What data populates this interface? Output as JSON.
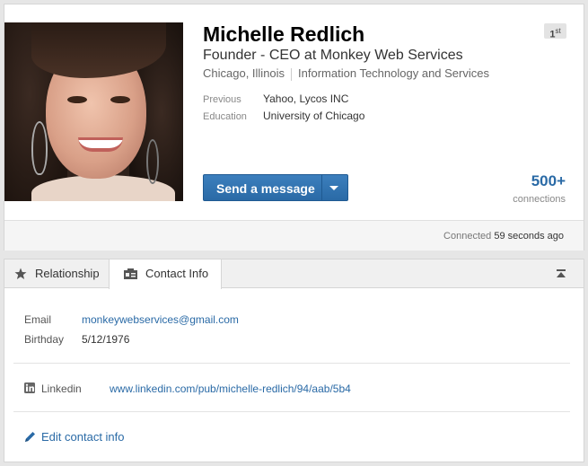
{
  "profile": {
    "name": "Michelle Redlich",
    "headline": "Founder - CEO at Monkey Web Services",
    "location": "Chicago, Illinois",
    "industry": "Information Technology and Services",
    "degree_badge": "1",
    "degree_suffix": "st",
    "previous_label": "Previous",
    "previous_value": "Yahoo, Lycos INC",
    "education_label": "Education",
    "education_value": "University of Chicago",
    "message_button": "Send a message",
    "connections_count": "500+",
    "connections_label": "connections",
    "connected_prefix": "Connected",
    "connected_time": "59 seconds ago"
  },
  "tabs": {
    "relationship": "Relationship",
    "contact_info": "Contact Info"
  },
  "contact": {
    "email_label": "Email",
    "email_value": "monkeywebservices@gmail.com",
    "birthday_label": "Birthday",
    "birthday_value": "5/12/1976",
    "linkedin_label": "Linkedin",
    "linkedin_value": "www.linkedin.com/pub/michelle-redlich/94/aab/5b4",
    "edit_label": "Edit contact info"
  },
  "icons": {
    "relationship": "star-icon",
    "contact_info": "contact-card-icon",
    "linkedin": "linkedin-icon",
    "edit": "pencil-icon",
    "collapse": "collapse-up-icon"
  },
  "colors": {
    "accent": "#2a6aa6",
    "button": "#2f73b1"
  }
}
